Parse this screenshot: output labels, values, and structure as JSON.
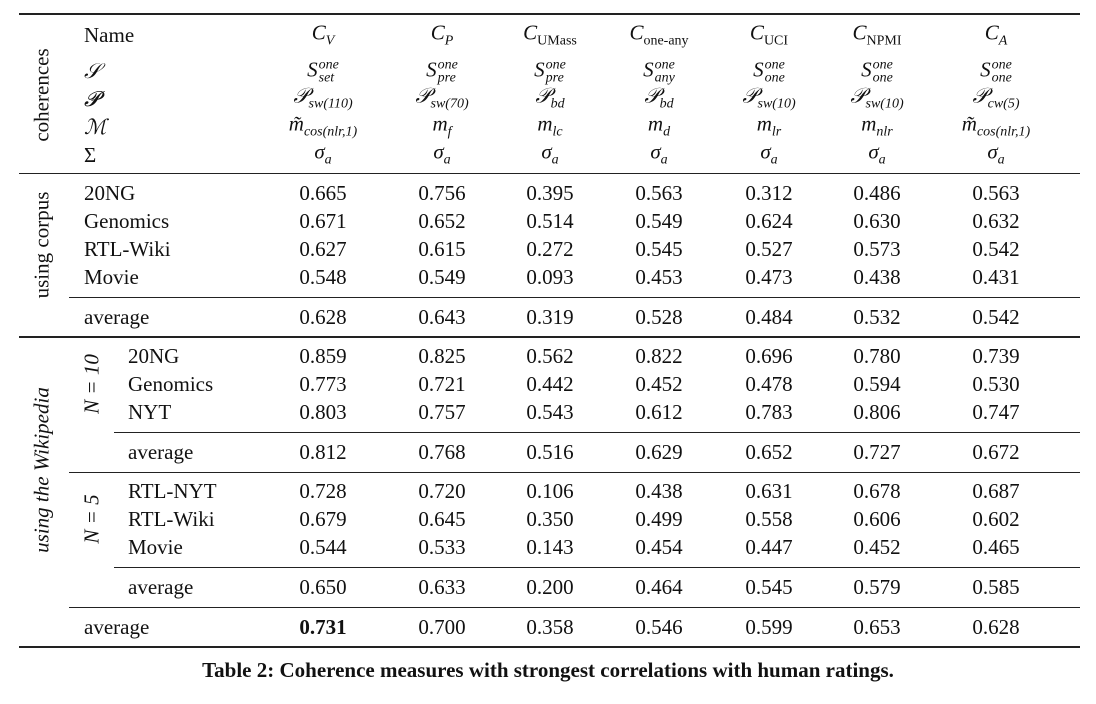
{
  "header": {
    "name_label": "Name",
    "row_labels": [
      "𝒮",
      "𝓟",
      "ℳ",
      "Σ"
    ],
    "group_label": "coherences",
    "columns": [
      {
        "name": {
          "base": "C",
          "sub": "V",
          "sub_upright": false
        },
        "S": {
          "sup": "one",
          "sub": "set"
        },
        "P": {
          "sub": "sw(110)"
        },
        "M": {
          "tilde": true,
          "sub": "cos(nlr,1)"
        },
        "Sigma": {
          "sub": "a"
        }
      },
      {
        "name": {
          "base": "C",
          "sub": "P",
          "sub_upright": false
        },
        "S": {
          "sup": "one",
          "sub": "pre"
        },
        "P": {
          "sub": "sw(70)"
        },
        "M": {
          "tilde": false,
          "sub": "f"
        },
        "Sigma": {
          "sub": "a"
        }
      },
      {
        "name": {
          "base": "C",
          "sub": "UMass",
          "sub_upright": true
        },
        "S": {
          "sup": "one",
          "sub": "pre"
        },
        "P": {
          "sub": "bd"
        },
        "M": {
          "tilde": false,
          "sub": "lc"
        },
        "Sigma": {
          "sub": "a"
        }
      },
      {
        "name": {
          "base": "C",
          "sub": "one-any",
          "sub_upright": true
        },
        "S": {
          "sup": "one",
          "sub": "any"
        },
        "P": {
          "sub": "bd"
        },
        "M": {
          "tilde": false,
          "sub": "d"
        },
        "Sigma": {
          "sub": "a"
        }
      },
      {
        "name": {
          "base": "C",
          "sub": "UCI",
          "sub_upright": true
        },
        "S": {
          "sup": "one",
          "sub": "one"
        },
        "P": {
          "sub": "sw(10)"
        },
        "M": {
          "tilde": false,
          "sub": "lr"
        },
        "Sigma": {
          "sub": "a"
        }
      },
      {
        "name": {
          "base": "C",
          "sub": "NPMI",
          "sub_upright": true
        },
        "S": {
          "sup": "one",
          "sub": "one"
        },
        "P": {
          "sub": "sw(10)"
        },
        "M": {
          "tilde": false,
          "sub": "nlr"
        },
        "Sigma": {
          "sub": "a"
        }
      },
      {
        "name": {
          "base": "C",
          "sub": "A",
          "sub_upright": false
        },
        "S": {
          "sup": "one",
          "sub": "one"
        },
        "P": {
          "sub": "cw(5)"
        },
        "M": {
          "tilde": true,
          "sub": "cos(nlr,1)"
        },
        "Sigma": {
          "sub": "a"
        }
      }
    ]
  },
  "corpus": {
    "group_label": "using corpus",
    "rows": [
      {
        "name": "20NG",
        "values": [
          "0.665",
          "0.756",
          "0.395",
          "0.563",
          "0.312",
          "0.486",
          "0.563"
        ]
      },
      {
        "name": "Genomics",
        "values": [
          "0.671",
          "0.652",
          "0.514",
          "0.549",
          "0.624",
          "0.630",
          "0.632"
        ]
      },
      {
        "name": "RTL-Wiki",
        "values": [
          "0.627",
          "0.615",
          "0.272",
          "0.545",
          "0.527",
          "0.573",
          "0.542"
        ]
      },
      {
        "name": "Movie",
        "values": [
          "0.548",
          "0.549",
          "0.093",
          "0.453",
          "0.473",
          "0.438",
          "0.431"
        ]
      }
    ],
    "average": {
      "name": "average",
      "values": [
        "0.628",
        "0.643",
        "0.319",
        "0.528",
        "0.484",
        "0.532",
        "0.542"
      ]
    }
  },
  "wikipedia": {
    "group_label": "using the Wikipedia",
    "subgroups": [
      {
        "label": "N = 10",
        "rows": [
          {
            "name": "20NG",
            "values": [
              "0.859",
              "0.825",
              "0.562",
              "0.822",
              "0.696",
              "0.780",
              "0.739"
            ]
          },
          {
            "name": "Genomics",
            "values": [
              "0.773",
              "0.721",
              "0.442",
              "0.452",
              "0.478",
              "0.594",
              "0.530"
            ]
          },
          {
            "name": "NYT",
            "values": [
              "0.803",
              "0.757",
              "0.543",
              "0.612",
              "0.783",
              "0.806",
              "0.747"
            ]
          }
        ],
        "average": {
          "name": "average",
          "values": [
            "0.812",
            "0.768",
            "0.516",
            "0.629",
            "0.652",
            "0.727",
            "0.672"
          ]
        }
      },
      {
        "label": "N = 5",
        "rows": [
          {
            "name": "RTL-NYT",
            "values": [
              "0.728",
              "0.720",
              "0.106",
              "0.438",
              "0.631",
              "0.678",
              "0.687"
            ]
          },
          {
            "name": "RTL-Wiki",
            "values": [
              "0.679",
              "0.645",
              "0.350",
              "0.499",
              "0.558",
              "0.606",
              "0.602"
            ]
          },
          {
            "name": "Movie",
            "values": [
              "0.544",
              "0.533",
              "0.143",
              "0.454",
              "0.447",
              "0.452",
              "0.465"
            ]
          }
        ],
        "average": {
          "name": "average",
          "values": [
            "0.650",
            "0.633",
            "0.200",
            "0.464",
            "0.545",
            "0.579",
            "0.585"
          ]
        }
      }
    ]
  },
  "overall_average": {
    "name": "average",
    "values": [
      "0.731",
      "0.700",
      "0.358",
      "0.546",
      "0.599",
      "0.653",
      "0.628"
    ],
    "bold_index": 0
  },
  "caption": "Table 2: Coherence measures with strongest correlations with human ratings."
}
